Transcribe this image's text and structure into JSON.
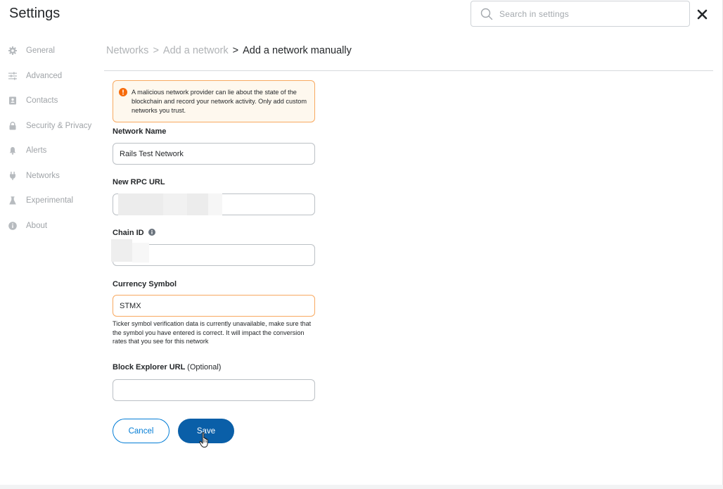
{
  "header": {
    "title": "Settings",
    "search_placeholder": "Search in settings"
  },
  "sidebar": {
    "items": [
      {
        "label": "General",
        "icon": "gear-icon"
      },
      {
        "label": "Advanced",
        "icon": "sliders-icon"
      },
      {
        "label": "Contacts",
        "icon": "contact-book-icon"
      },
      {
        "label": "Security & Privacy",
        "icon": "lock-icon"
      },
      {
        "label": "Alerts",
        "icon": "bell-icon"
      },
      {
        "label": "Networks",
        "icon": "plug-icon"
      },
      {
        "label": "Experimental",
        "icon": "flask-icon"
      },
      {
        "label": "About",
        "icon": "info-icon"
      }
    ]
  },
  "breadcrumb": {
    "items": [
      "Networks",
      "Add a network"
    ],
    "current": "Add a network manually",
    "separator": ">"
  },
  "warning": {
    "text": "A malicious network provider can lie about the state of the blockchain and record your network activity. Only add custom networks you trust."
  },
  "form": {
    "network_name": {
      "label": "Network Name",
      "value": "Rails Test Network"
    },
    "rpc_url": {
      "label": "New RPC URL",
      "value": ""
    },
    "chain_id": {
      "label": "Chain ID",
      "value": ""
    },
    "currency_symbol": {
      "label": "Currency Symbol",
      "value": "STMX"
    },
    "currency_helper": "Ticker symbol verification data is currently unavailable, make sure that the symbol you have entered is correct. It will impact the conversion rates that you see for this network",
    "block_explorer": {
      "label": "Block Explorer URL",
      "optional": "(Optional)",
      "value": ""
    }
  },
  "buttons": {
    "cancel": "Cancel",
    "save": "Save"
  },
  "colors": {
    "primary": "#037dd6",
    "save_bg": "#0a5fa8",
    "warning_border": "#f8a960",
    "warning_bg": "#fef8ee",
    "warning_icon": "#f66a0a"
  }
}
